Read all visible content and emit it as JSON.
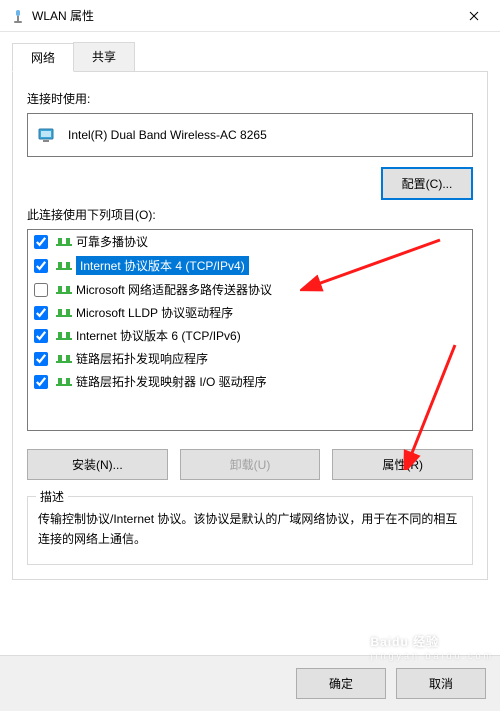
{
  "window": {
    "title": "WLAN 属性"
  },
  "tabs": {
    "network": "网络",
    "sharing": "共享"
  },
  "labels": {
    "connect_using": "连接时使用:",
    "adapter": "Intel(R) Dual Band Wireless-AC 8265",
    "configure": "配置(C)...",
    "items_label": "此连接使用下列项目(O):",
    "install": "安装(N)...",
    "uninstall": "卸载(U)",
    "properties": "属性(R)",
    "desc_legend": "描述",
    "desc_text": "传输控制协议/Internet 协议。该协议是默认的广域网络协议，用于在不同的相互连接的网络上通信。",
    "ok": "确定",
    "cancel": "取消"
  },
  "items": [
    {
      "checked": true,
      "label": "可靠多播协议"
    },
    {
      "checked": true,
      "label": "Internet 协议版本 4 (TCP/IPv4)",
      "selected": true
    },
    {
      "checked": false,
      "label": "Microsoft 网络适配器多路传送器协议"
    },
    {
      "checked": true,
      "label": "Microsoft LLDP 协议驱动程序"
    },
    {
      "checked": true,
      "label": "Internet 协议版本 6 (TCP/IPv6)"
    },
    {
      "checked": true,
      "label": "链路层拓扑发现响应程序"
    },
    {
      "checked": true,
      "label": "链路层拓扑发现映射器 I/O 驱动程序"
    }
  ],
  "watermark": {
    "brand": "Baidu 经验",
    "sub": "jingyan.baidu.com"
  }
}
